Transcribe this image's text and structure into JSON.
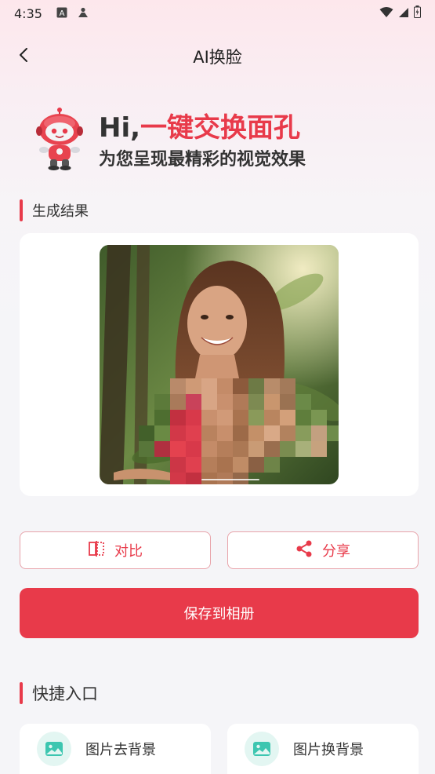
{
  "status_bar": {
    "time": "4:35",
    "left_icons": [
      "a-box-icon",
      "person-icon"
    ],
    "right_icons": [
      "wifi-icon",
      "signal-icon",
      "battery-icon"
    ]
  },
  "nav": {
    "title": "AI换脸",
    "back_icon": "back-arrow-icon"
  },
  "hero": {
    "title_prefix": "Hi,",
    "title_accent": "一键交换面孔",
    "subtitle": "为您呈现最精彩的视觉效果"
  },
  "result_section": {
    "label": "生成结果"
  },
  "actions": {
    "compare_label": "对比",
    "share_label": "分享",
    "save_label": "保存到相册"
  },
  "quick_section": {
    "label": "快捷入口",
    "items": [
      {
        "label": "图片去背景",
        "icon": "image-icon"
      },
      {
        "label": "图片换背景",
        "icon": "image-icon"
      }
    ]
  },
  "colors": {
    "accent": "#e83a4a",
    "teal": "#3cc6b0"
  }
}
